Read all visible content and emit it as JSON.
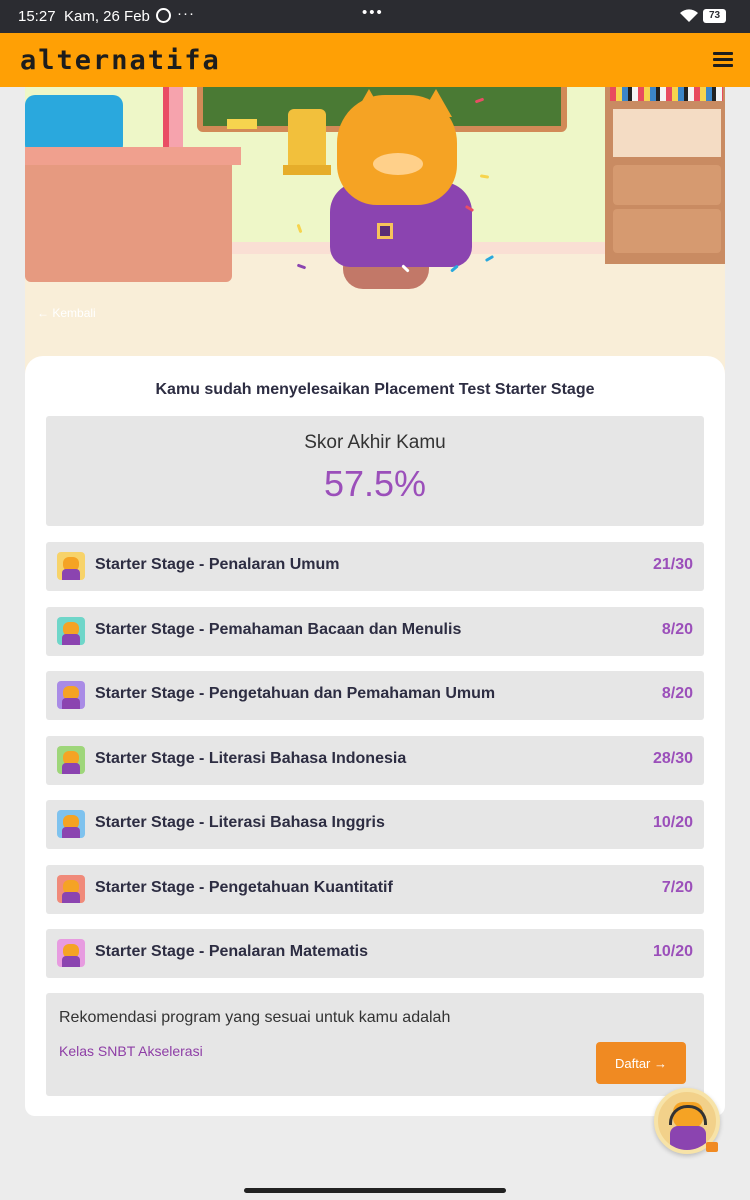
{
  "status_bar": {
    "time": "15:27",
    "date": "Kam, 26 Feb",
    "battery": "73",
    "more": "···",
    "center_dots": "•••"
  },
  "app_bar": {
    "logo": "alternatifa",
    "brand_color": "#ffa005"
  },
  "hero": {
    "back_label": "Kembali"
  },
  "result": {
    "title": "Kamu sudah menyelesaikan Placement Test Starter Stage",
    "score_label": "Skor Akhir Kamu",
    "score_value": "57.5%",
    "sections": [
      {
        "name": "Starter Stage - Penalaran Umum",
        "score": "21/30",
        "icon_bg": "#f7d36a"
      },
      {
        "name": "Starter Stage - Pemahaman Bacaan dan Menulis",
        "score": "8/20",
        "icon_bg": "#6fd6c9"
      },
      {
        "name": "Starter Stage - Pengetahuan dan Pemahaman Umum",
        "score": "8/20",
        "icon_bg": "#a98be6"
      },
      {
        "name": "Starter Stage - Literasi Bahasa Indonesia",
        "score": "28/30",
        "icon_bg": "#9ed67a"
      },
      {
        "name": "Starter Stage - Literasi Bahasa Inggris",
        "score": "10/20",
        "icon_bg": "#7ec2ee"
      },
      {
        "name": "Starter Stage - Pengetahuan Kuantitatif",
        "score": "7/20",
        "icon_bg": "#f08a7a"
      },
      {
        "name": "Starter Stage - Penalaran Matematis",
        "score": "10/20",
        "icon_bg": "#e79be0"
      }
    ]
  },
  "recommendation": {
    "text": "Rekomendasi program yang sesuai untuk kamu adalah",
    "program": "Kelas SNBT Akselerasi",
    "button_label": "Daftar",
    "button_arrow": "→"
  },
  "colors": {
    "accent_purple": "#9b4fba",
    "button_orange": "#f08a22"
  }
}
